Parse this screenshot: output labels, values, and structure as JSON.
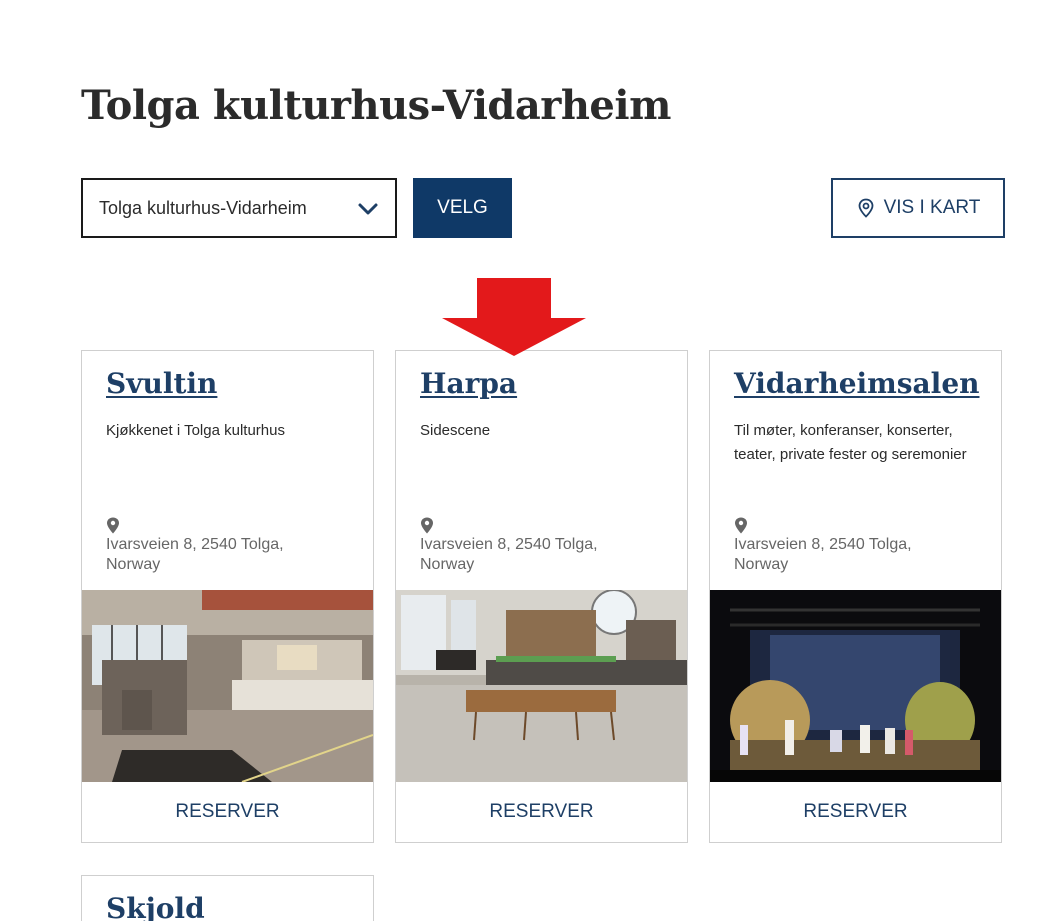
{
  "page": {
    "title": "Tolga kulturhus-Vidarheim"
  },
  "filter": {
    "selected_location": "Tolga kulturhus-Vidarheim",
    "submit_label": "VELG",
    "map_label": "VIS I KART"
  },
  "cards": [
    {
      "title": "Svultin",
      "description": "Kjøkkenet i Tolga kulturhus",
      "address": "Ivarsveien 8, 2540 Tolga, Norway",
      "reserve_label": "RESERVER",
      "image_icon": "kitchen-photo"
    },
    {
      "title": "Harpa",
      "description": "Sidescene",
      "address": "Ivarsveien 8, 2540 Tolga, Norway",
      "reserve_label": "RESERVER",
      "image_icon": "stage-room-photo"
    },
    {
      "title": "Vidarheimsalen",
      "description": "Til møter, konferanser, konserter, teater, private fester og seremonier",
      "address": "Ivarsveien 8, 2540 Tolga, Norway",
      "reserve_label": "RESERVER",
      "image_icon": "theatre-stage-photo"
    },
    {
      "title": "Skjold"
    }
  ],
  "colors": {
    "primary": "#0f3967",
    "link": "#1e3f66",
    "annotation_arrow": "#e3191b",
    "card_border": "#cfcfcf"
  }
}
